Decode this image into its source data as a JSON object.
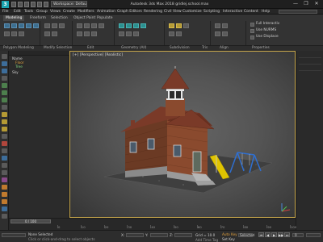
{
  "app": {
    "title": "Autodesk 3ds Max 2018  gridlej.school.max",
    "logo_text": "3",
    "workspace_label": "Workspace: Default",
    "search_placeholder": "",
    "window_controls": [
      "—",
      "❐",
      "✕"
    ]
  },
  "menu": {
    "items": [
      "File",
      "Edit",
      "Tools",
      "Group",
      "Views",
      "Create",
      "Modifiers",
      "Animation",
      "Graph Editors",
      "Rendering",
      "Civil View",
      "Customize",
      "Scripting",
      "Interactive",
      "Content",
      "Help"
    ]
  },
  "ribbon": {
    "tabs": [
      "Modeling",
      "Freeform",
      "Selection",
      "Object Paint",
      "Populate"
    ],
    "groups": [
      {
        "name": "Polygon Modeling"
      },
      {
        "name": "Modify Selection"
      },
      {
        "name": "Edit"
      },
      {
        "name": "Geometry (All)"
      },
      {
        "name": "Subdivision"
      },
      {
        "name": "Align"
      },
      {
        "name": "Properties"
      }
    ],
    "properties_items": [
      "Full Interactiv",
      "Use NURMS",
      "Use Displace"
    ],
    "bottom_tabs": [
      "Polygon Modeling",
      "Modify Selection",
      "Edit",
      "Geometry (All)",
      "Subdivision",
      "Tris",
      "Align",
      "Properties"
    ]
  },
  "scene_explorer": {
    "lines": [
      {
        "text": "Name",
        "color": "normal"
      },
      {
        "text": "Floor",
        "color": "orange"
      },
      {
        "text": "Tree",
        "color": "green"
      },
      {
        "text": "Sky",
        "color": "normal"
      }
    ],
    "footer_label": "Default   H   ..."
  },
  "viewport": {
    "label": "[+] [Perspective] [Realistic]"
  },
  "timeline": {
    "slider_label": "0 / 100",
    "ticks": [
      "0",
      "10",
      "20",
      "30",
      "40",
      "50",
      "60",
      "70",
      "80",
      "90",
      "100"
    ]
  },
  "statusbar": {
    "selection_text": "None Selected",
    "prompt_text": "Click or click-and-drag to select objects",
    "coord_x_label": "X:",
    "coord_y_label": "Y:",
    "coord_z_label": "Z:",
    "grid_label": "Grid = 10.0",
    "add_time_tag": "Add Time Tag",
    "auto_key": "Auto Key",
    "set_key": "Set Key",
    "selected_label": "Selected",
    "playback": [
      "⏮",
      "◀",
      "▶",
      "▶▶",
      "⏭"
    ],
    "frame_value": "0"
  },
  "colors": {
    "accent_viewport_border": "#c6a64b",
    "app_logo": "#1aa3b0",
    "slide_yellow": "#e0c400",
    "swing_blue": "#2f6fd0",
    "brick": "#8a4a2e"
  }
}
